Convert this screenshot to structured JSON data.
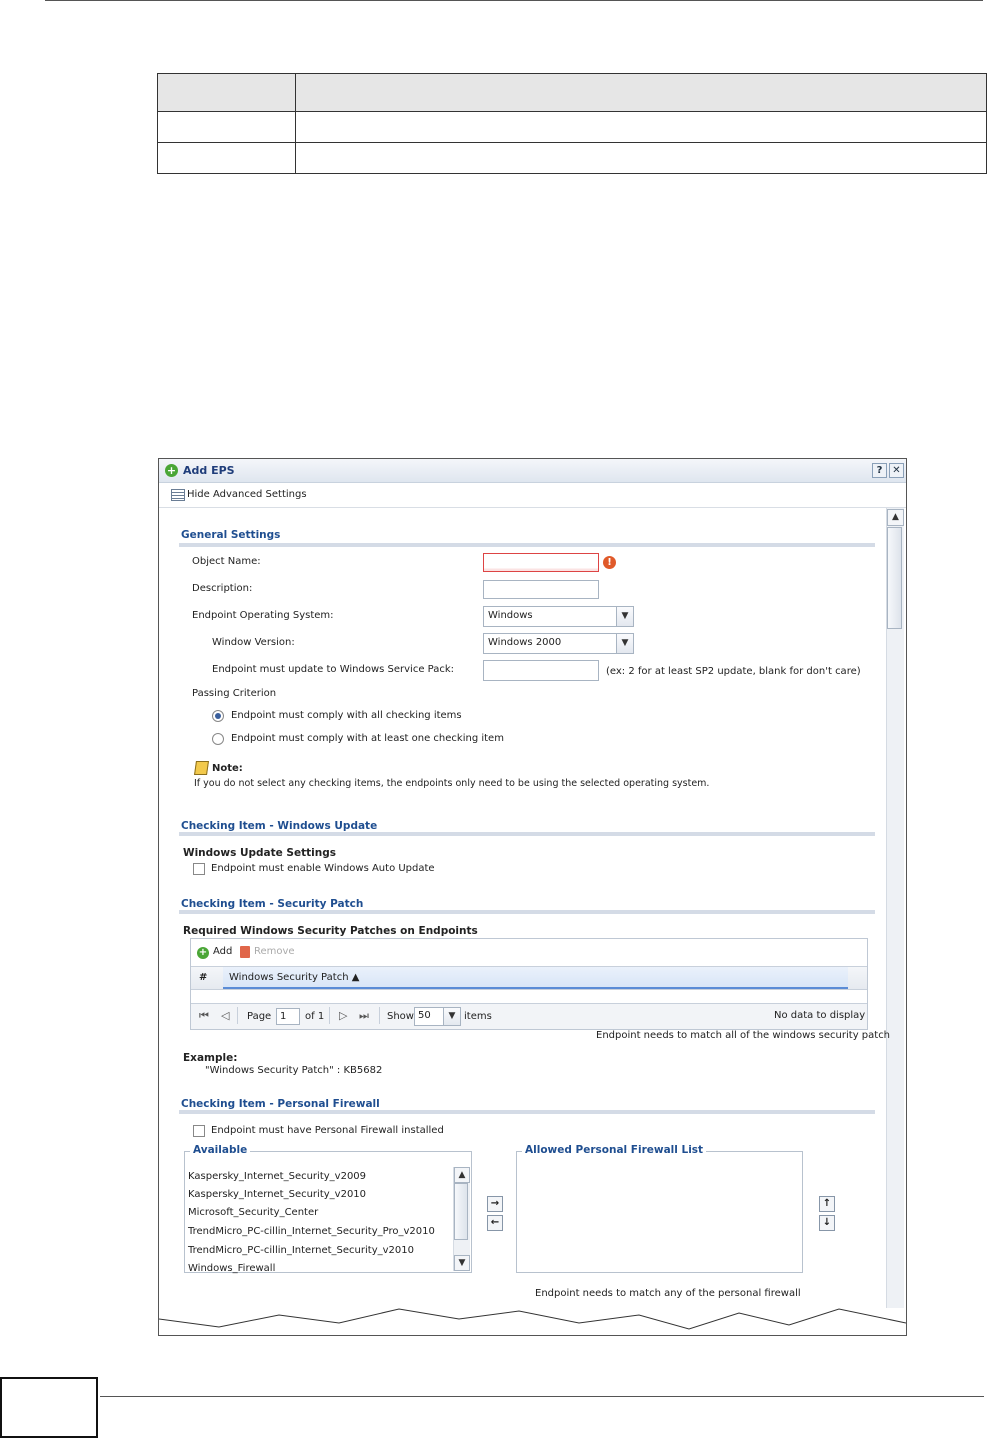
{
  "window": {
    "title": "Add EPS",
    "help_label": "?",
    "close_label": "✕",
    "toolbar_toggle": "Hide Advanced Settings"
  },
  "general": {
    "heading": "General Settings",
    "object_name_label": "Object Name:",
    "description_label": "Description:",
    "os_label": "Endpoint Operating System:",
    "os_value": "Windows",
    "version_label": "Window Version:",
    "version_value": "Windows 2000",
    "sp_label": "Endpoint must update to Windows Service Pack:",
    "sp_hint": "(ex: 2 for at least SP2 update, blank for don't care)",
    "passing_label": "Passing Criterion",
    "radio_all": "Endpoint must comply with all checking items",
    "radio_one": "Endpoint must comply with at least one checking item",
    "note_title": "Note:",
    "note_text": "If you do not select any checking items, the endpoints only need to be using the selected operating system."
  },
  "windows_update": {
    "heading": "Checking Item - Windows Update",
    "subheading": "Windows Update Settings",
    "checkbox_label": "Endpoint must enable Windows Auto Update"
  },
  "security_patch": {
    "heading": "Checking Item - Security Patch",
    "subheading": "Required Windows Security Patches on Endpoints",
    "add_label": "Add",
    "remove_label": "Remove",
    "col_num": "#",
    "col_patch": "Windows Security Patch ▲",
    "page_label": "Page",
    "page_value": "1",
    "of_label": "of 1",
    "show_label": "Show",
    "show_value": "50",
    "items_label": "items",
    "no_data": "No data to display",
    "match_note": "Endpoint needs to match all of the windows security patch",
    "example_label": "Example:",
    "example_text": "\"Windows Security Patch\" : KB5682"
  },
  "firewall": {
    "heading": "Checking Item - Personal Firewall",
    "checkbox_label": "Endpoint must have Personal Firewall installed",
    "available_legend": "Available",
    "allowed_legend": "Allowed Personal Firewall List",
    "available_items": [
      "Kaspersky_Internet_Security_v2009",
      "Kaspersky_Internet_Security_v2010",
      "Microsoft_Security_Center",
      "TrendMicro_PC-cillin_Internet_Security_Pro_v2010",
      "TrendMicro_PC-cillin_Internet_Security_v2010",
      "Windows_Firewall"
    ],
    "match_note": "Endpoint needs to match any of the personal firewall"
  }
}
